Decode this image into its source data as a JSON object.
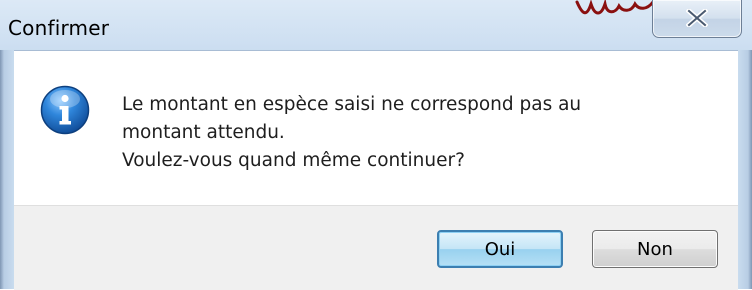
{
  "window": {
    "title": "Confirmer",
    "close_icon": "close-icon"
  },
  "dialog": {
    "icon": "info-icon",
    "message_lines": [
      "Le montant en espèce saisi ne correspond pas au",
      "montant attendu.",
      "Voulez-vous quand même continuer?"
    ]
  },
  "buttons": {
    "yes_label": "Oui",
    "no_label": "Non"
  },
  "colors": {
    "accent": "#3c7fb1",
    "icon_blue": "#1f6fc5",
    "frame": "#c7dbef"
  }
}
